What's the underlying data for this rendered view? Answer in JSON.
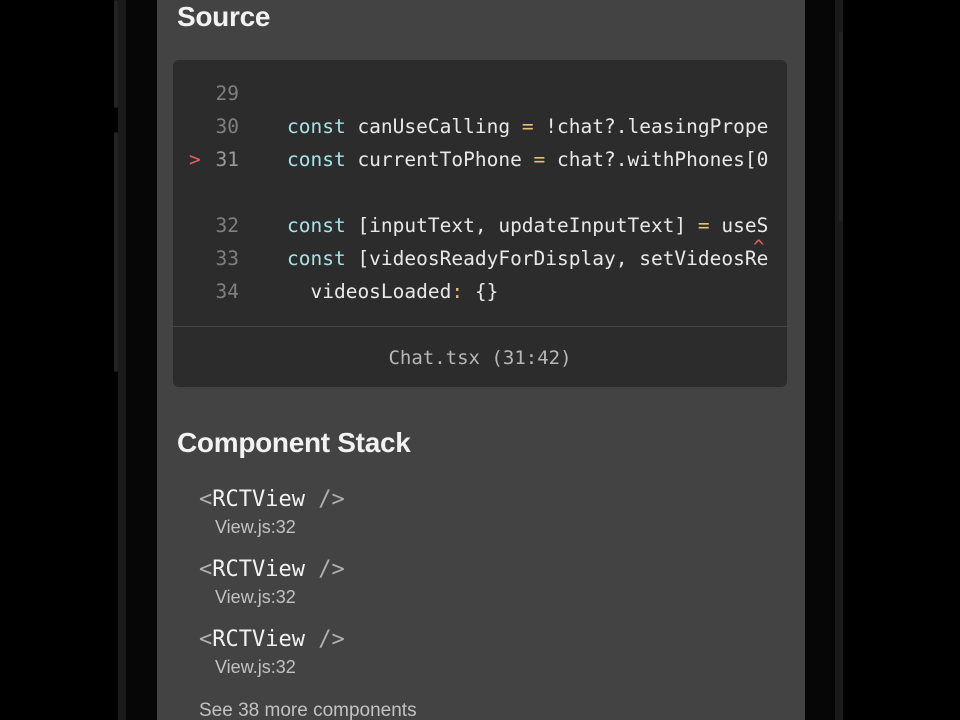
{
  "source": {
    "title": "Source",
    "lines": [
      {
        "num": "29",
        "code": "",
        "marker": ""
      },
      {
        "num": "30",
        "kw": "const",
        "rest": " canUseCalling ",
        "op": "=",
        "rest2": " !chat?.leasingPrope",
        "marker": ""
      },
      {
        "num": "31",
        "kw": "const",
        "rest": " currentToPhone ",
        "op": "=",
        "rest2": " chat?.withPhones[0",
        "marker": ">"
      },
      {
        "num": "32",
        "kw": "const",
        "rest": " [inputText, updateInputText] ",
        "op": "=",
        "rest2": " useS",
        "marker": ""
      },
      {
        "num": "33",
        "kw": "const",
        "rest": " [videosReadyForDisplay, setVideosRe",
        "op": "",
        "rest2": "",
        "marker": ""
      },
      {
        "num": "34",
        "kw": "",
        "rest": "  videosLoaded",
        "op": ":",
        "rest2": " {}",
        "marker": ""
      }
    ],
    "caret": "^",
    "file_location": "Chat.tsx (31:42)"
  },
  "component_stack": {
    "title": "Component Stack",
    "items": [
      {
        "open": "<",
        "name": "RCTView",
        "close": " />",
        "file": "View.js:32"
      },
      {
        "open": "<",
        "name": "RCTView",
        "close": " />",
        "file": "View.js:32"
      },
      {
        "open": "<",
        "name": "RCTView",
        "close": " />",
        "file": "View.js:32"
      }
    ],
    "see_more": "See 38 more components"
  },
  "colors": {
    "screen_bg": "#434343",
    "code_bg": "#2c2c2c",
    "keyword": "#a6e3e6",
    "operator": "#e5c07b",
    "error_marker": "#e0635f"
  }
}
